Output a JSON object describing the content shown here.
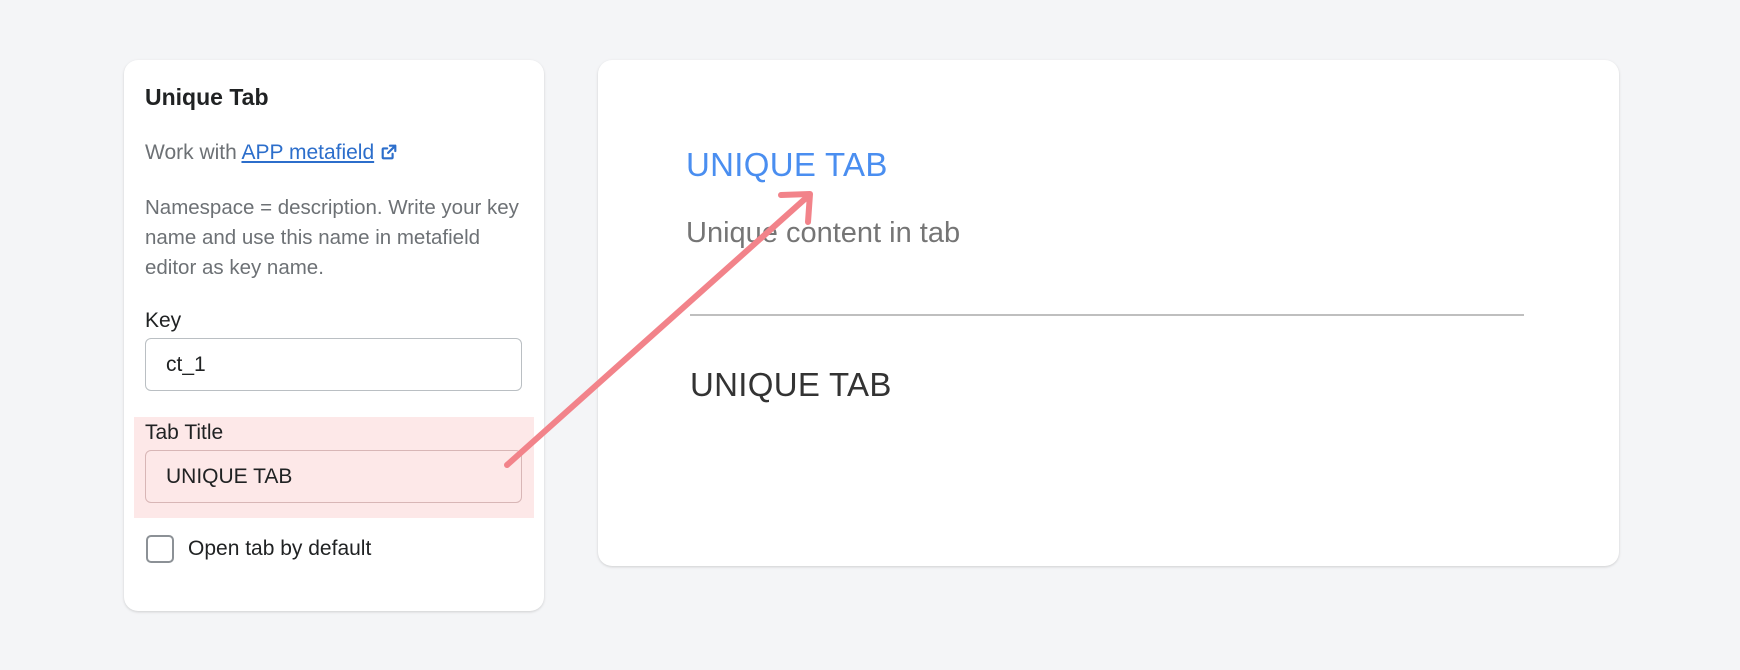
{
  "settings": {
    "title": "Unique Tab",
    "work_with_prefix": "Work with ",
    "link_label": "APP metafield",
    "description": "Namespace = description. Write your key name and use this name in metafield editor as key name.",
    "key_label": "Key",
    "key_value": "ct_1",
    "tab_title_label": "Tab Title",
    "tab_title_value": "UNIQUE TAB",
    "checkbox_label": "Open tab by default",
    "checkbox_checked": false
  },
  "preview": {
    "tab_title": "UNIQUE TAB",
    "content": "Unique content in tab",
    "tab_heading": "UNIQUE TAB"
  },
  "colors": {
    "link": "#2c6ecb",
    "preview_title": "#4a8ef0",
    "highlight": "#fde8e8",
    "annotation_arrow": "#f2838a"
  },
  "icons": {
    "external_link": "external-link-icon",
    "annotation": "arrow-annotation-icon"
  }
}
